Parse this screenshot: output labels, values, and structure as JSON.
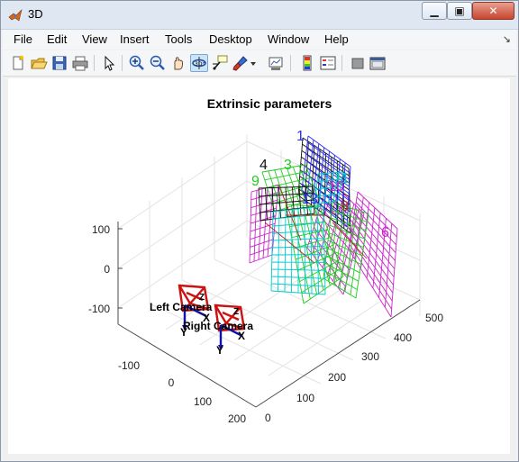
{
  "window": {
    "title": "3D"
  },
  "menu": [
    "File",
    "Edit",
    "View",
    "Insert",
    "Tools",
    "Desktop",
    "Window",
    "Help"
  ],
  "toolbar_icons": [
    "new-figure-icon",
    "open-file-icon",
    "save-icon",
    "print-icon",
    "edit-plot-icon",
    "zoom-in-icon",
    "zoom-out-icon",
    "pan-icon",
    "rotate-3d-icon",
    "data-cursor-icon",
    "brush-icon",
    "brush-dropdown-icon",
    "link-plot-icon",
    "insert-colorbar-icon",
    "insert-legend-icon",
    "hide-plot-tools-icon",
    "show-plot-tools-icon"
  ],
  "axes": {
    "title": "Extrinsic parameters",
    "z_ticks": [
      "100",
      "0",
      "-100"
    ],
    "x_ticks": [
      "-100",
      "0",
      "100",
      "200"
    ],
    "y_ticks": [
      "0",
      "100",
      "200",
      "300",
      "400",
      "500"
    ]
  },
  "cameras": {
    "left_label": "Left Camera",
    "right_label": "Right Camera",
    "x_axis_label": "X",
    "y_axis_label": "Y",
    "z_axis_label": "Z"
  },
  "board_labels": [
    "1",
    "4",
    "3",
    "9",
    "13",
    "11",
    "10",
    "8",
    "6"
  ],
  "colors": {
    "camera_frame": "#cc1111",
    "camera_axes": "#1010aa",
    "board_blue": "#2a2aff",
    "board_cyan": "#00cccc",
    "board_green": "#22cc22",
    "board_magenta": "#cc22cc",
    "board_black": "#111111",
    "board_red": "#b0302a"
  }
}
